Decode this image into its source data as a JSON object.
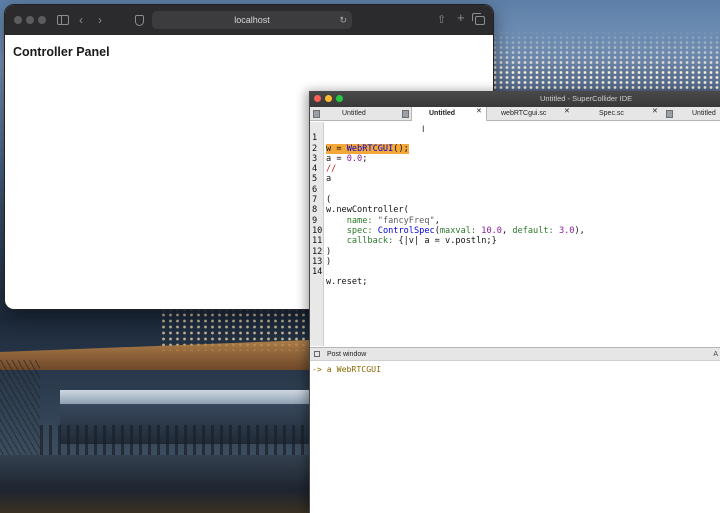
{
  "browser": {
    "url": "localhost",
    "page_title": "Controller Panel"
  },
  "ide": {
    "title": "Untitled - SuperCollider IDE",
    "tabs": [
      {
        "label": "Untitled"
      },
      {
        "label": "Untitled",
        "active": true
      },
      {
        "label": "webRTCgui.sc"
      },
      {
        "label": "Spec.sc"
      },
      {
        "label": "Untitled"
      }
    ],
    "code_lines": [
      {
        "n": "1",
        "text": "w = WebRTCGUI();"
      },
      {
        "n": "2",
        "text": "a = 0.0;"
      },
      {
        "n": "3",
        "text": "//"
      },
      {
        "n": "4",
        "text": "a"
      },
      {
        "n": "5",
        "text": ""
      },
      {
        "n": "6",
        "text": "("
      },
      {
        "n": "7",
        "text": "w.newController("
      },
      {
        "n": "8",
        "text": "    name: \"fancyFreq\","
      },
      {
        "n": "9",
        "text": "    spec: ControlSpec(maxval: 10.0, default: 3.0),"
      },
      {
        "n": "10",
        "text": "    callback: {|v| a = v.postln;}"
      },
      {
        "n": "11",
        "text": ")"
      },
      {
        "n": "12",
        "text": ")"
      },
      {
        "n": "13",
        "text": ""
      },
      {
        "n": "14",
        "text": "w.reset;"
      }
    ],
    "post_window": {
      "label": "Post window",
      "corner": "A",
      "output": "-> a WebRTCGUI"
    }
  },
  "colors": {
    "highlight": "#f5a83a",
    "class": "#0000d9",
    "number": "#8c1a9e",
    "comment": "#c0191e",
    "symbol": "#2d7a2d",
    "post_text": "#8a6a00"
  },
  "icons": [
    "sidebar-icon",
    "back-icon",
    "forward-icon",
    "shield-icon",
    "reload-icon",
    "share-icon",
    "new-tab-icon",
    "tab-overview-icon",
    "document-icon",
    "close-icon",
    "text-cursor-icon"
  ]
}
